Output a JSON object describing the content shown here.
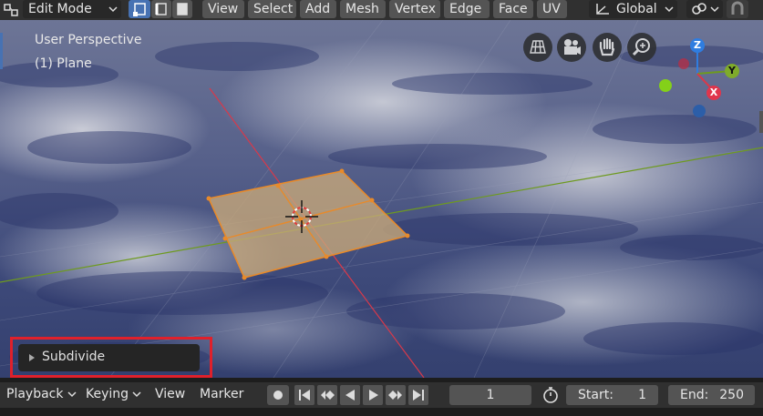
{
  "top_bar": {
    "mode_label": "Edit Mode",
    "menus": [
      "View",
      "Select",
      "Add",
      "Mesh",
      "Vertex",
      "Edge",
      "Face",
      "UV"
    ],
    "transform_orientation": "Global"
  },
  "viewport": {
    "perspective_label": "User Perspective",
    "object_label": "(1) Plane",
    "gizmo": {
      "x": "X",
      "y": "Y",
      "z": "Z"
    },
    "colors": {
      "x_axis": "#d8394a",
      "y_axis": "#6e9a1f",
      "z_axis": "#2f7de0",
      "selection": "#e88a2a",
      "face_fill": "#c9a97a",
      "highlight_box": "#e0202b"
    }
  },
  "operator_panel": {
    "label": "Subdivide"
  },
  "timeline": {
    "playback_label": "Playback",
    "keying_label": "Keying",
    "view_label": "View",
    "marker_label": "Marker",
    "current_frame": "1",
    "start_label": "Start:",
    "start_value": "1",
    "end_label": "End:",
    "end_value": "250"
  }
}
